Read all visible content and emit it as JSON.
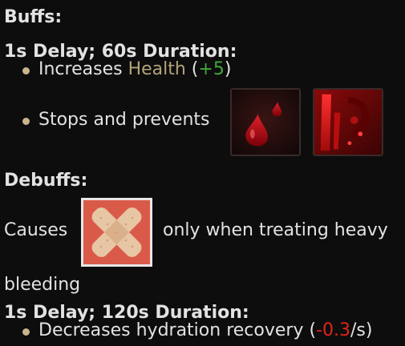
{
  "buffs": {
    "heading": "Buffs:",
    "group1": {
      "header": "1s Delay; 60s Duration:",
      "effect1": {
        "prefix": "Increases ",
        "stat": "Health",
        "open_paren": " (",
        "value": "+5",
        "close_paren": ")"
      },
      "effect2": {
        "text": "Stops and prevents",
        "icons": [
          "blood-drops-icon",
          "bleeding-wound-icon"
        ]
      }
    }
  },
  "debuffs": {
    "heading": "Debuffs:",
    "causes_prefix": "Causes",
    "causes_icon": "bandage-pain-icon",
    "causes_suffix": "only when treating heavy",
    "causes_wrap": "bleeding",
    "group1": {
      "header": "1s Delay; 120s Duration:",
      "effect1": {
        "prefix": "Decreases hydration recovery (",
        "value": "-0.3",
        "suffix": "/s)"
      }
    }
  },
  "colors": {
    "background": "#0d0d0d",
    "text": "#e2e2e2",
    "stat_name": "#b2a37a",
    "positive": "#3fa83a",
    "negative": "#e2231a"
  }
}
